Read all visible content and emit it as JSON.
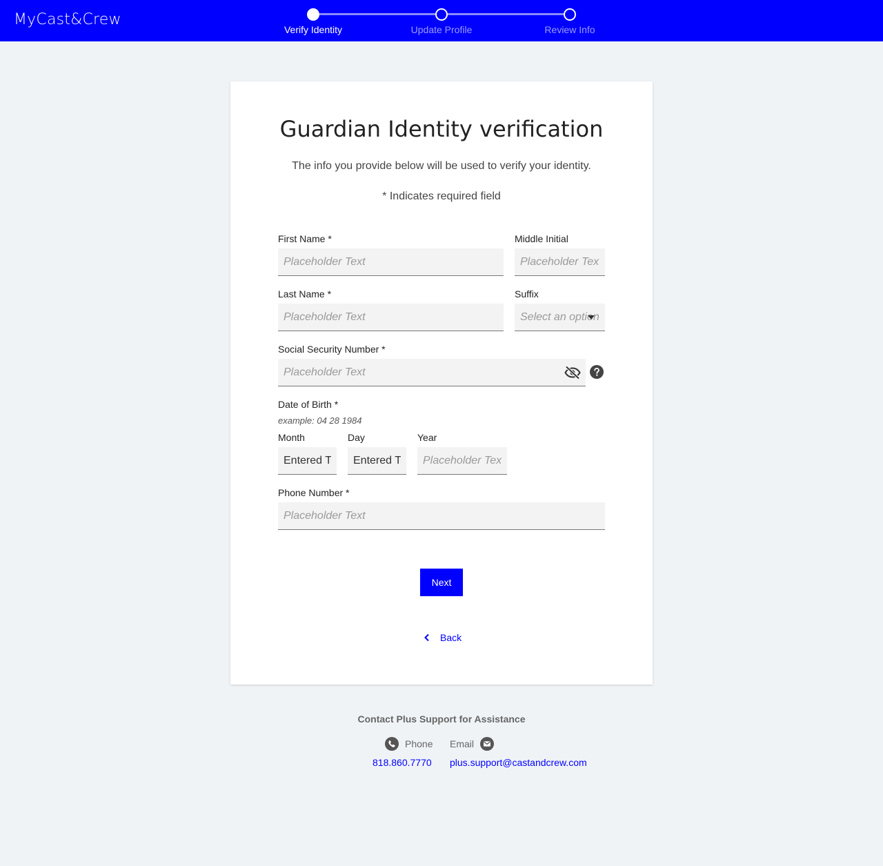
{
  "header": {
    "logo": "MyCast&Crew",
    "steps": [
      {
        "label": "Verify Identity",
        "active": true
      },
      {
        "label": "Update Profile",
        "active": false
      },
      {
        "label": "Review Info",
        "active": false
      }
    ]
  },
  "form": {
    "title": "Guardian Identity verification",
    "subtitle": "The info you provide below will be used to verify your identity.",
    "required_note": "* Indicates required field",
    "first_name": {
      "label": "First Name *",
      "placeholder": "Placeholder Text",
      "value": ""
    },
    "middle_initial": {
      "label": "Middle Initial",
      "placeholder": "Placeholder Text",
      "value": ""
    },
    "last_name": {
      "label": "Last Name *",
      "placeholder": "Placeholder Text",
      "value": ""
    },
    "suffix": {
      "label": "Suffix",
      "placeholder": "Select an option"
    },
    "ssn": {
      "label": "Social Security Number *",
      "placeholder": "Placeholder Text",
      "value": "",
      "icons": [
        "eye-off-icon",
        "help-icon"
      ]
    },
    "dob": {
      "label": "Date of Birth *",
      "example": "example:  04  28  1984",
      "month": {
        "label": "Month",
        "value": "Entered Text"
      },
      "day": {
        "label": "Day",
        "value": "Entered Text"
      },
      "year": {
        "label": "Year",
        "placeholder": "Placeholder Text",
        "value": ""
      }
    },
    "phone": {
      "label": "Phone Number *",
      "placeholder": "Placeholder Text",
      "value": ""
    },
    "next_label": "Next",
    "back_label": "Back"
  },
  "footer": {
    "title": "Contact Plus Support for Assistance",
    "phone_label": "Phone",
    "email_label": "Email",
    "phone_value": "818.860.7770",
    "email_value": "plus.support@castandcrew.com"
  },
  "colors": {
    "brand": "#0000ff",
    "background": "#f0f3f6",
    "input_bg": "#f3f3f3"
  }
}
